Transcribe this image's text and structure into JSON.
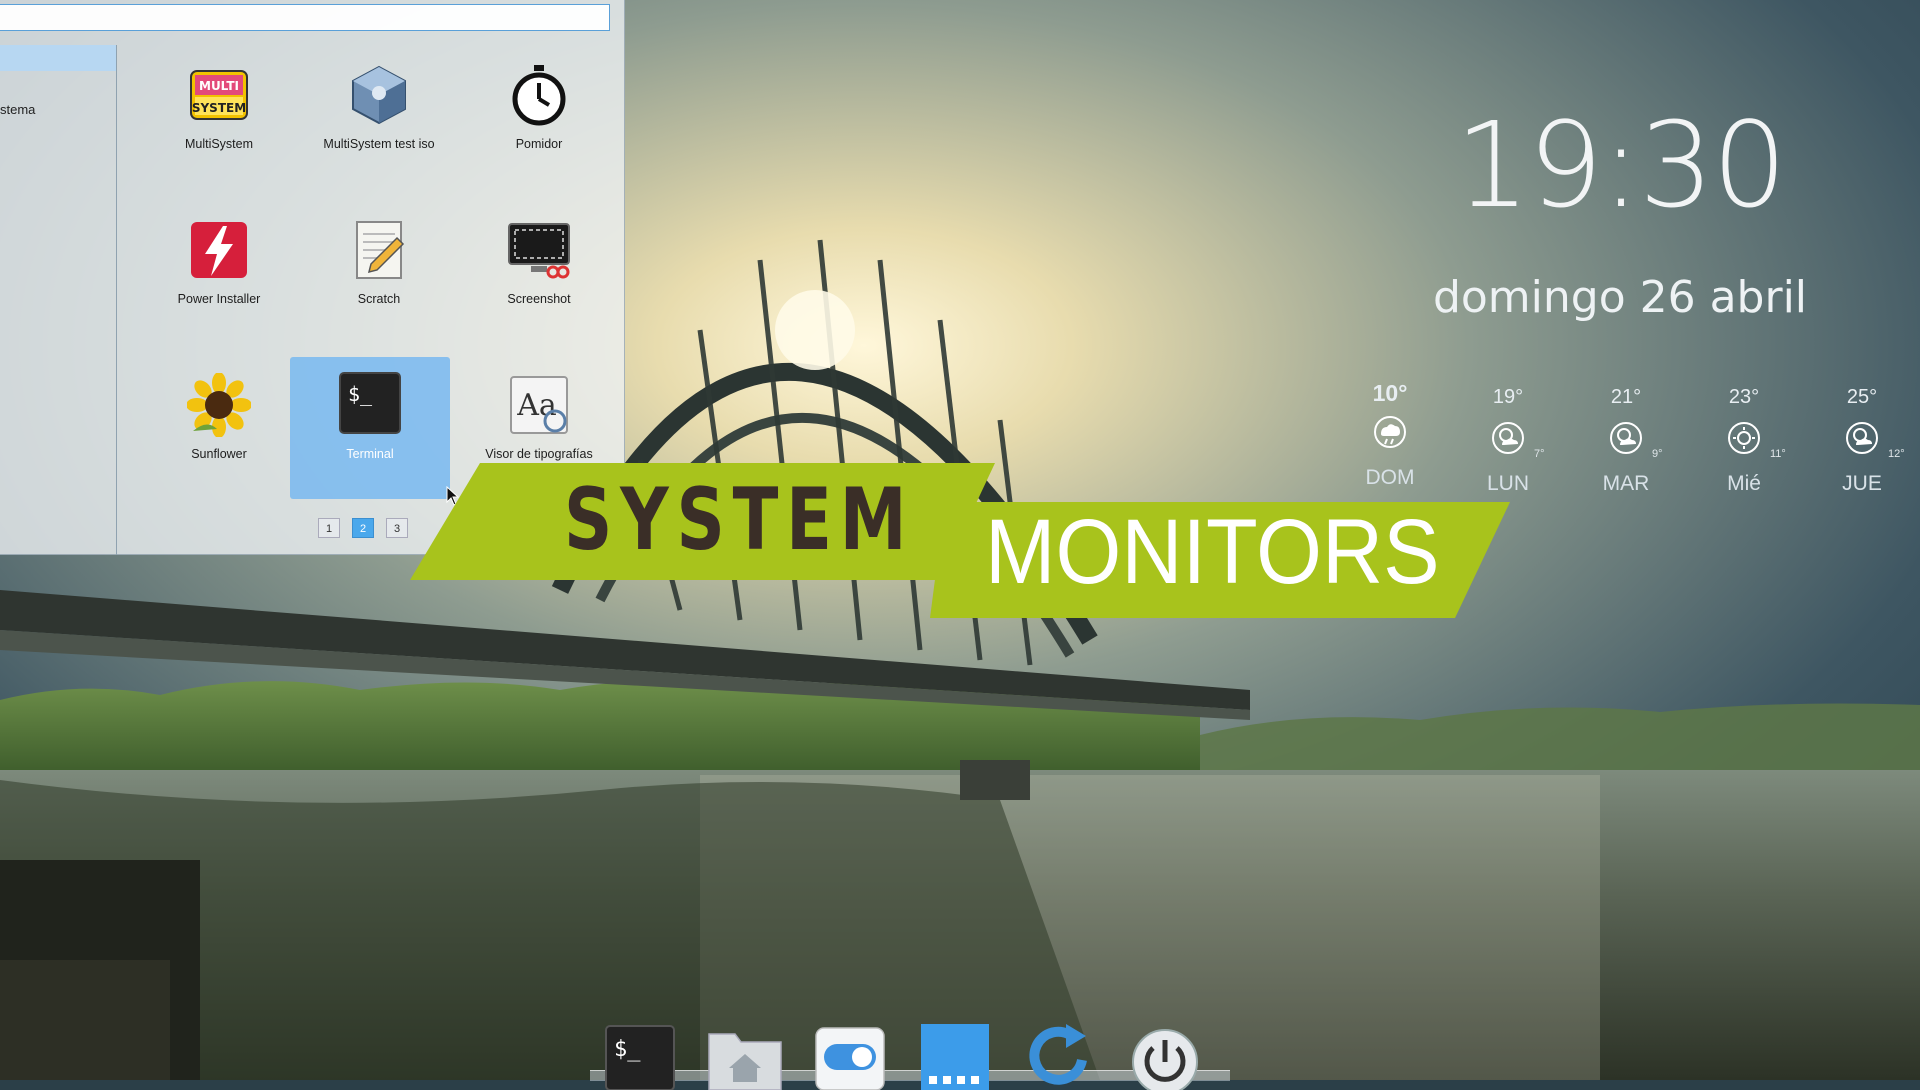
{
  "launcher": {
    "search_placeholder": "",
    "categories": [
      {
        "label": ""
      },
      {
        "label": "stema"
      }
    ],
    "apps": [
      {
        "label": "MultiSystem"
      },
      {
        "label": "MultiSystem test iso"
      },
      {
        "label": "Pomidor"
      },
      {
        "label": "Power Installer"
      },
      {
        "label": "Scratch"
      },
      {
        "label": "Screenshot"
      },
      {
        "label": "Sunflower"
      },
      {
        "label": "Terminal"
      },
      {
        "label": "Visor de tipografías"
      }
    ],
    "selected_app": "Terminal",
    "pages": [
      "1",
      "2",
      "3"
    ],
    "active_page": "2",
    "icon_texts": {
      "multisystem_logo": "MULTI SYSTEM",
      "terminal_prompt": "$_",
      "font_viewer": "Aa"
    }
  },
  "banner": {
    "line1": "SYSTEM",
    "line2": "MONITORS",
    "color": "#a8c31c"
  },
  "clock": {
    "time": "19:30",
    "date": "domingo 26 abril"
  },
  "weather": [
    {
      "high": "10°",
      "low": "",
      "day": "DOM",
      "icon": "cloud-rain-icon"
    },
    {
      "high": "19°",
      "low": "7°",
      "day": "LUN",
      "icon": "partly-sunny-icon"
    },
    {
      "high": "21°",
      "low": "9°",
      "day": "MAR",
      "icon": "partly-sunny-icon"
    },
    {
      "high": "23°",
      "low": "11°",
      "day": "Mié",
      "icon": "sun-icon"
    },
    {
      "high": "25°",
      "low": "12°",
      "day": "JUE",
      "icon": "partly-sunny-icon"
    }
  ],
  "dock": {
    "items": [
      "terminal-icon",
      "home-folder-icon",
      "toggle-settings-icon",
      "launcher-grid-icon",
      "update-icon",
      "power-icon"
    ],
    "terminal_text": "$_"
  },
  "colors": {
    "accent_blue": "#4aa8ec",
    "banner_green": "#a8c31c",
    "sky": "#2e4a58"
  }
}
